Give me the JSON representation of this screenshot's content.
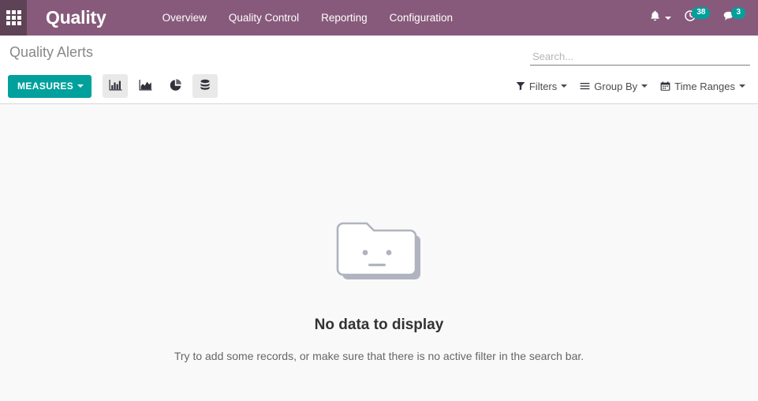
{
  "navbar": {
    "apps_icon": "apps-grid-icon",
    "brand": "Quality",
    "menu_items": [
      {
        "label": "Overview"
      },
      {
        "label": "Quality Control"
      },
      {
        "label": "Reporting"
      },
      {
        "label": "Configuration"
      }
    ],
    "right": {
      "bell_icon": "bell-icon",
      "activities_icon": "clock-icon",
      "activities_count": "38",
      "messages_icon": "speech-bubble-icon",
      "messages_count": "3"
    },
    "colors": {
      "background": "#875a7b",
      "apps_background": "#5d4355",
      "badge": "#00a09d"
    }
  },
  "control_panel": {
    "breadcrumb": "Quality Alerts",
    "search": {
      "placeholder": "Search...",
      "value": "",
      "icon": "search-icon"
    },
    "measures": {
      "label": "MEASURES",
      "color": "#00a09d"
    },
    "view_buttons": [
      {
        "name": "bar-chart",
        "active": true
      },
      {
        "name": "line-chart",
        "active": false
      },
      {
        "name": "pie-chart",
        "active": false
      },
      {
        "name": "pivot-table",
        "active": true
      }
    ],
    "filters": [
      {
        "label": "Filters",
        "icon": "funnel-icon"
      },
      {
        "label": "Group By",
        "icon": "bars-icon"
      },
      {
        "label": "Time Ranges",
        "icon": "calendar-icon"
      }
    ]
  },
  "content": {
    "empty_state": {
      "illustration": "folder-neutral-face-icon",
      "title": "No data to display",
      "subtitle": "Try to add some records, or make sure that there is no active filter in the search bar."
    }
  }
}
